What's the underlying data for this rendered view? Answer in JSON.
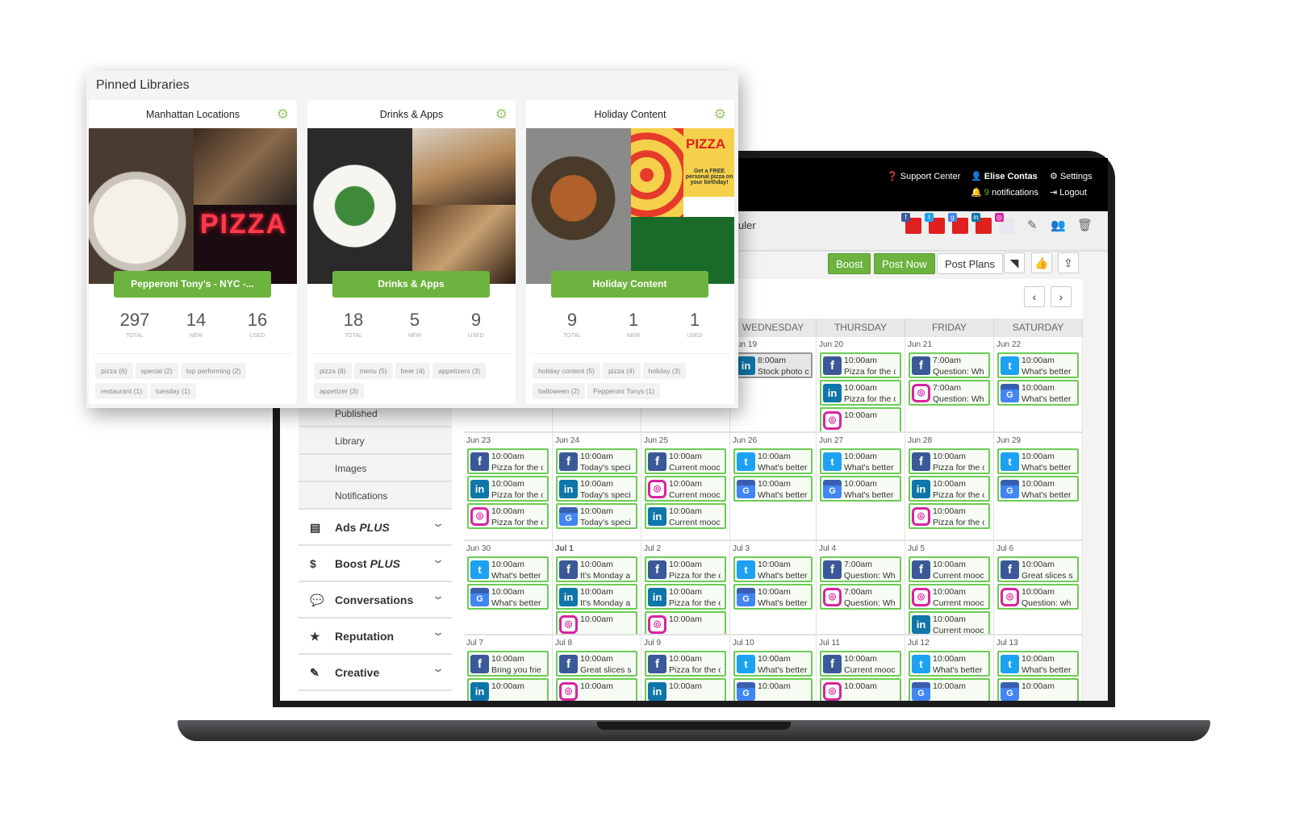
{
  "header": {
    "support": "Support Center",
    "user": "Elise Contas",
    "settings": "Settings",
    "notif_count": "9",
    "notif_label": "notifications",
    "logout": "Logout"
  },
  "subheader": {
    "title_fragment": "uler",
    "networks": [
      "facebook",
      "twitter",
      "google-my-business",
      "linkedin",
      "instagram"
    ]
  },
  "toolbar": {
    "boost": "Boost",
    "post_now": "Post Now",
    "post_plans": "Post Plans",
    "icons": [
      "rss-icon",
      "thumbs-up-icon",
      "upload-icon"
    ]
  },
  "nav": {
    "prev": "‹",
    "next": "›"
  },
  "colors": {
    "accent": "#6db33f",
    "facebook": "#3b5998",
    "linkedin": "#0e76a8",
    "twitter": "#1da1f2",
    "instagram": "#d6249f",
    "gmb": "#4285f4"
  },
  "calendar": {
    "days": [
      "SUNDAY",
      "MONDAY",
      "TUESDAY",
      "WEDNESDAY",
      "THURSDAY",
      "FRIDAY",
      "SATURDAY"
    ],
    "weeks": [
      [
        null,
        null,
        null,
        {
          "date": "Jun 19",
          "posts": [
            {
              "net": "linkedin",
              "time": "8:00am",
              "text": "Stock photo c",
              "state": "gray"
            }
          ]
        },
        {
          "date": "Jun 20",
          "posts": [
            {
              "net": "facebook",
              "time": "10:00am",
              "text": "Pizza for the c"
            },
            {
              "net": "linkedin",
              "time": "10:00am",
              "text": "Pizza for the c"
            },
            {
              "net": "instagram",
              "time": "10:00am",
              "text": ""
            }
          ]
        },
        {
          "date": "Jun 21",
          "posts": [
            {
              "net": "facebook",
              "time": "7:00am",
              "text": "Question: Wh"
            },
            {
              "net": "instagram",
              "time": "7:00am",
              "text": "Question: Wh"
            }
          ]
        },
        {
          "date": "Jun 22",
          "posts": [
            {
              "net": "twitter",
              "time": "10:00am",
              "text": "What's better"
            },
            {
              "net": "gmb",
              "time": "10:00am",
              "text": "What's better"
            }
          ]
        }
      ],
      [
        {
          "date": "Jun 23",
          "posts": [
            {
              "net": "facebook",
              "time": "10:00am",
              "text": "Pizza for the c"
            },
            {
              "net": "linkedin",
              "time": "10:00am",
              "text": "Pizza for the c"
            },
            {
              "net": "instagram",
              "time": "10:00am",
              "text": "Pizza for the c"
            }
          ]
        },
        {
          "date": "Jun 24",
          "posts": [
            {
              "net": "facebook",
              "time": "10:00am",
              "text": "Today's speci"
            },
            {
              "net": "linkedin",
              "time": "10:00am",
              "text": "Today's speci"
            },
            {
              "net": "gmb",
              "time": "10:00am",
              "text": "Today's speci"
            }
          ]
        },
        {
          "date": "Jun 25",
          "posts": [
            {
              "net": "facebook",
              "time": "10:00am",
              "text": "Current mooc"
            },
            {
              "net": "instagram",
              "time": "10:00am",
              "text": "Current mooc"
            },
            {
              "net": "linkedin",
              "time": "10:00am",
              "text": "Current mooc"
            }
          ]
        },
        {
          "date": "Jun 26",
          "posts": [
            {
              "net": "twitter",
              "time": "10:00am",
              "text": "What's better"
            },
            {
              "net": "gmb",
              "time": "10:00am",
              "text": "What's better"
            }
          ]
        },
        {
          "date": "Jun 27",
          "posts": [
            {
              "net": "twitter",
              "time": "10:00am",
              "text": "What's better"
            },
            {
              "net": "gmb",
              "time": "10:00am",
              "text": "What's better"
            }
          ]
        },
        {
          "date": "Jun 28",
          "posts": [
            {
              "net": "facebook",
              "time": "10:00am",
              "text": "Pizza for the c"
            },
            {
              "net": "linkedin",
              "time": "10:00am",
              "text": "Pizza for the c"
            },
            {
              "net": "instagram",
              "time": "10:00am",
              "text": "Pizza for the c"
            }
          ]
        },
        {
          "date": "Jun 29",
          "posts": [
            {
              "net": "twitter",
              "time": "10:00am",
              "text": "What's better"
            },
            {
              "net": "gmb",
              "time": "10:00am",
              "text": "What's better"
            }
          ]
        }
      ],
      [
        {
          "date": "Jun 30",
          "posts": [
            {
              "net": "twitter",
              "time": "10:00am",
              "text": "What's better"
            },
            {
              "net": "gmb",
              "time": "10:00am",
              "text": "What's better"
            }
          ]
        },
        {
          "date": "Jul 1",
          "bold": true,
          "posts": [
            {
              "net": "facebook",
              "time": "10:00am",
              "text": "It's Monday a"
            },
            {
              "net": "linkedin",
              "time": "10:00am",
              "text": "It's Monday a"
            },
            {
              "net": "instagram",
              "time": "10:00am",
              "text": ""
            }
          ]
        },
        {
          "date": "Jul 2",
          "posts": [
            {
              "net": "facebook",
              "time": "10:00am",
              "text": "Pizza for the c"
            },
            {
              "net": "linkedin",
              "time": "10:00am",
              "text": "Pizza for the c"
            },
            {
              "net": "instagram",
              "time": "10:00am",
              "text": ""
            }
          ]
        },
        {
          "date": "Jul 3",
          "posts": [
            {
              "net": "twitter",
              "time": "10:00am",
              "text": "What's better"
            },
            {
              "net": "gmb",
              "time": "10:00am",
              "text": "What's better"
            }
          ]
        },
        {
          "date": "Jul 4",
          "posts": [
            {
              "net": "facebook",
              "time": "7:00am",
              "text": "Question: Wh"
            },
            {
              "net": "instagram",
              "time": "7:00am",
              "text": "Question: Wh"
            }
          ]
        },
        {
          "date": "Jul 5",
          "posts": [
            {
              "net": "facebook",
              "time": "10:00am",
              "text": "Current mooc"
            },
            {
              "net": "instagram",
              "time": "10:00am",
              "text": "Current mooc"
            },
            {
              "net": "linkedin",
              "time": "10:00am",
              "text": "Current mooc"
            }
          ]
        },
        {
          "date": "Jul 6",
          "posts": [
            {
              "net": "facebook",
              "time": "10:00am",
              "text": "Great slices s"
            },
            {
              "net": "instagram",
              "time": "10:00am",
              "text": "Question: wh"
            }
          ]
        }
      ],
      [
        {
          "date": "Jul 7",
          "posts": [
            {
              "net": "facebook",
              "time": "10:00am",
              "text": "Bring you frie"
            },
            {
              "net": "linkedin",
              "time": "10:00am",
              "text": ""
            }
          ]
        },
        {
          "date": "Jul 8",
          "posts": [
            {
              "net": "facebook",
              "time": "10:00am",
              "text": "Great slices s"
            },
            {
              "net": "instagram",
              "time": "10:00am",
              "text": ""
            }
          ]
        },
        {
          "date": "Jul 9",
          "posts": [
            {
              "net": "facebook",
              "time": "10:00am",
              "text": "Pizza for the c"
            },
            {
              "net": "linkedin",
              "time": "10:00am",
              "text": ""
            }
          ]
        },
        {
          "date": "Jul 10",
          "posts": [
            {
              "net": "twitter",
              "time": "10:00am",
              "text": "What's better"
            },
            {
              "net": "gmb",
              "time": "10:00am",
              "text": ""
            }
          ]
        },
        {
          "date": "Jul 11",
          "posts": [
            {
              "net": "facebook",
              "time": "10:00am",
              "text": "Current mooc"
            },
            {
              "net": "instagram",
              "time": "10:00am",
              "text": ""
            }
          ]
        },
        {
          "date": "Jul 12",
          "posts": [
            {
              "net": "twitter",
              "time": "10:00am",
              "text": "What's better"
            },
            {
              "net": "gmb",
              "time": "10:00am",
              "text": ""
            }
          ]
        },
        {
          "date": "Jul 13",
          "posts": [
            {
              "net": "twitter",
              "time": "10:00am",
              "text": "What's better"
            },
            {
              "net": "gmb",
              "time": "10:00am",
              "text": ""
            }
          ]
        }
      ]
    ]
  },
  "sidebar": {
    "sub": [
      "Published",
      "Library",
      "Images",
      "Notifications"
    ],
    "sections": [
      {
        "label": "Ads",
        "suffix": "PLUS",
        "icon": "newspaper-icon",
        "glyph": "▤"
      },
      {
        "label": "Boost",
        "suffix": "PLUS",
        "icon": "dollar-icon",
        "glyph": "$"
      },
      {
        "label": "Conversations",
        "suffix": "",
        "icon": "comments-icon",
        "glyph": "💬"
      },
      {
        "label": "Reputation",
        "suffix": "",
        "icon": "star-icon",
        "glyph": "★"
      },
      {
        "label": "Creative",
        "suffix": "",
        "icon": "brush-icon",
        "glyph": "✎"
      }
    ]
  },
  "pinned": {
    "title": "Pinned Libraries",
    "stat_labels": [
      "TOTAL",
      "NEW",
      "USED"
    ],
    "libraries": [
      {
        "name": "Manhattan Locations",
        "button": "Pepperoni Tony's - NYC -...",
        "stats": [
          "297",
          "14",
          "16"
        ],
        "tags": [
          "pizza (6)",
          "special (2)",
          "top performing (2)",
          "restaurant (1)",
          "tuesday (1)"
        ],
        "image_text": "PIZZA"
      },
      {
        "name": "Drinks & Apps",
        "button": "Drinks & Apps",
        "stats": [
          "18",
          "5",
          "9"
        ],
        "tags": [
          "pizza (8)",
          "menu (5)",
          "beer (4)",
          "appetizers (3)",
          "appetizer (3)"
        ],
        "image_text": ""
      },
      {
        "name": "Holiday Content",
        "button": "Holiday Content",
        "stats": [
          "9",
          "1",
          "1"
        ],
        "tags": [
          "holiday content (5)",
          "pizza (4)",
          "holiday (3)",
          "halloween (2)",
          "Pepperoni Tonys (1)"
        ],
        "image_text": "PIZZA",
        "image_subtext": "Get a FREE personal pizza on your birthday!"
      }
    ]
  }
}
